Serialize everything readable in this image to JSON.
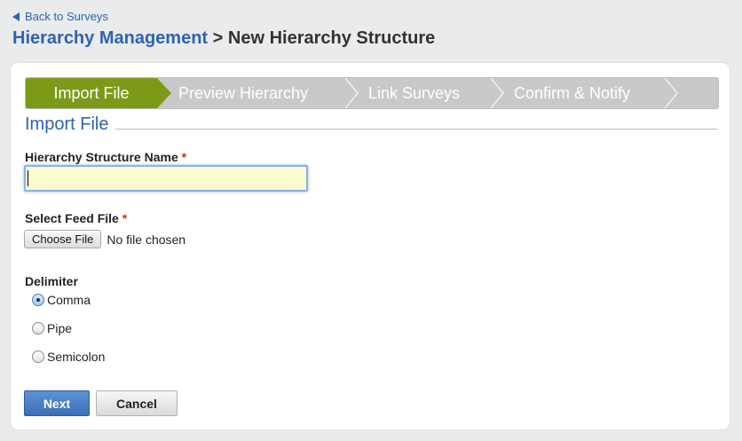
{
  "nav": {
    "back_label": "Back to Surveys"
  },
  "header": {
    "breadcrumb_parent": "Hierarchy Management",
    "separator": ">",
    "current_page": "New Hierarchy Structure"
  },
  "wizard": {
    "steps": [
      {
        "label": "Import File",
        "active": true
      },
      {
        "label": "Preview Hierarchy",
        "active": false
      },
      {
        "label": "Link Surveys",
        "active": false
      },
      {
        "label": "Confirm & Notify",
        "active": false
      }
    ]
  },
  "form": {
    "section_title": "Import File",
    "name_label": "Hierarchy Structure Name",
    "required_marker": "*",
    "name_value": "",
    "feed_label": "Select Feed File",
    "choose_file_label": "Choose File",
    "file_status": "No file chosen",
    "delimiter_label": "Delimiter",
    "delimiter_options": [
      {
        "label": "Comma",
        "checked": true
      },
      {
        "label": "Pipe",
        "checked": false
      },
      {
        "label": "Semicolon",
        "checked": false
      }
    ]
  },
  "actions": {
    "next_label": "Next",
    "cancel_label": "Cancel"
  },
  "colors": {
    "link": "#2e63b3",
    "active_step": "#7b9a18",
    "inactive_step": "#c9c9c9",
    "primary_button": "#4a7fc5",
    "required": "#c0302a",
    "input_focus_bg": "#fdfbd0"
  },
  "icons": {
    "back": "triangle-left-icon",
    "step_separator": "chevron-right-icon"
  }
}
